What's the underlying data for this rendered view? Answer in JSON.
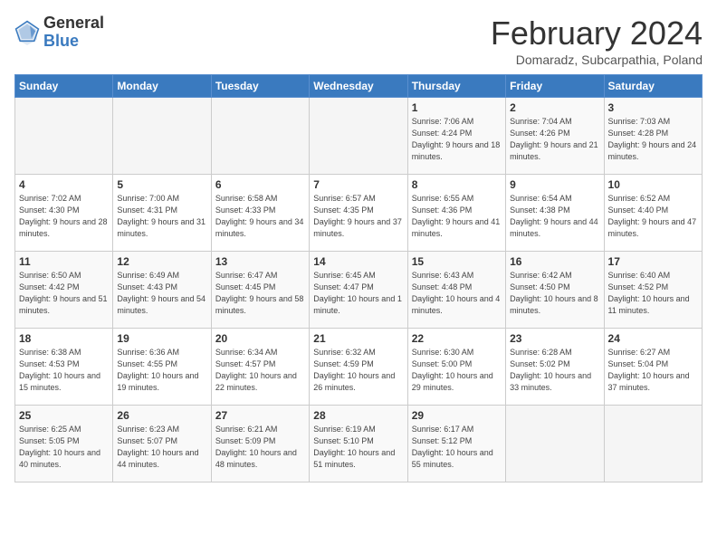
{
  "header": {
    "logo_general": "General",
    "logo_blue": "Blue",
    "month_title": "February 2024",
    "subtitle": "Domaradz, Subcarpathia, Poland"
  },
  "weekdays": [
    "Sunday",
    "Monday",
    "Tuesday",
    "Wednesday",
    "Thursday",
    "Friday",
    "Saturday"
  ],
  "weeks": [
    [
      {
        "day": "",
        "info": ""
      },
      {
        "day": "",
        "info": ""
      },
      {
        "day": "",
        "info": ""
      },
      {
        "day": "",
        "info": ""
      },
      {
        "day": "1",
        "info": "Sunrise: 7:06 AM\nSunset: 4:24 PM\nDaylight: 9 hours and 18 minutes."
      },
      {
        "day": "2",
        "info": "Sunrise: 7:04 AM\nSunset: 4:26 PM\nDaylight: 9 hours and 21 minutes."
      },
      {
        "day": "3",
        "info": "Sunrise: 7:03 AM\nSunset: 4:28 PM\nDaylight: 9 hours and 24 minutes."
      }
    ],
    [
      {
        "day": "4",
        "info": "Sunrise: 7:02 AM\nSunset: 4:30 PM\nDaylight: 9 hours and 28 minutes."
      },
      {
        "day": "5",
        "info": "Sunrise: 7:00 AM\nSunset: 4:31 PM\nDaylight: 9 hours and 31 minutes."
      },
      {
        "day": "6",
        "info": "Sunrise: 6:58 AM\nSunset: 4:33 PM\nDaylight: 9 hours and 34 minutes."
      },
      {
        "day": "7",
        "info": "Sunrise: 6:57 AM\nSunset: 4:35 PM\nDaylight: 9 hours and 37 minutes."
      },
      {
        "day": "8",
        "info": "Sunrise: 6:55 AM\nSunset: 4:36 PM\nDaylight: 9 hours and 41 minutes."
      },
      {
        "day": "9",
        "info": "Sunrise: 6:54 AM\nSunset: 4:38 PM\nDaylight: 9 hours and 44 minutes."
      },
      {
        "day": "10",
        "info": "Sunrise: 6:52 AM\nSunset: 4:40 PM\nDaylight: 9 hours and 47 minutes."
      }
    ],
    [
      {
        "day": "11",
        "info": "Sunrise: 6:50 AM\nSunset: 4:42 PM\nDaylight: 9 hours and 51 minutes."
      },
      {
        "day": "12",
        "info": "Sunrise: 6:49 AM\nSunset: 4:43 PM\nDaylight: 9 hours and 54 minutes."
      },
      {
        "day": "13",
        "info": "Sunrise: 6:47 AM\nSunset: 4:45 PM\nDaylight: 9 hours and 58 minutes."
      },
      {
        "day": "14",
        "info": "Sunrise: 6:45 AM\nSunset: 4:47 PM\nDaylight: 10 hours and 1 minute."
      },
      {
        "day": "15",
        "info": "Sunrise: 6:43 AM\nSunset: 4:48 PM\nDaylight: 10 hours and 4 minutes."
      },
      {
        "day": "16",
        "info": "Sunrise: 6:42 AM\nSunset: 4:50 PM\nDaylight: 10 hours and 8 minutes."
      },
      {
        "day": "17",
        "info": "Sunrise: 6:40 AM\nSunset: 4:52 PM\nDaylight: 10 hours and 11 minutes."
      }
    ],
    [
      {
        "day": "18",
        "info": "Sunrise: 6:38 AM\nSunset: 4:53 PM\nDaylight: 10 hours and 15 minutes."
      },
      {
        "day": "19",
        "info": "Sunrise: 6:36 AM\nSunset: 4:55 PM\nDaylight: 10 hours and 19 minutes."
      },
      {
        "day": "20",
        "info": "Sunrise: 6:34 AM\nSunset: 4:57 PM\nDaylight: 10 hours and 22 minutes."
      },
      {
        "day": "21",
        "info": "Sunrise: 6:32 AM\nSunset: 4:59 PM\nDaylight: 10 hours and 26 minutes."
      },
      {
        "day": "22",
        "info": "Sunrise: 6:30 AM\nSunset: 5:00 PM\nDaylight: 10 hours and 29 minutes."
      },
      {
        "day": "23",
        "info": "Sunrise: 6:28 AM\nSunset: 5:02 PM\nDaylight: 10 hours and 33 minutes."
      },
      {
        "day": "24",
        "info": "Sunrise: 6:27 AM\nSunset: 5:04 PM\nDaylight: 10 hours and 37 minutes."
      }
    ],
    [
      {
        "day": "25",
        "info": "Sunrise: 6:25 AM\nSunset: 5:05 PM\nDaylight: 10 hours and 40 minutes."
      },
      {
        "day": "26",
        "info": "Sunrise: 6:23 AM\nSunset: 5:07 PM\nDaylight: 10 hours and 44 minutes."
      },
      {
        "day": "27",
        "info": "Sunrise: 6:21 AM\nSunset: 5:09 PM\nDaylight: 10 hours and 48 minutes."
      },
      {
        "day": "28",
        "info": "Sunrise: 6:19 AM\nSunset: 5:10 PM\nDaylight: 10 hours and 51 minutes."
      },
      {
        "day": "29",
        "info": "Sunrise: 6:17 AM\nSunset: 5:12 PM\nDaylight: 10 hours and 55 minutes."
      },
      {
        "day": "",
        "info": ""
      },
      {
        "day": "",
        "info": ""
      }
    ]
  ]
}
